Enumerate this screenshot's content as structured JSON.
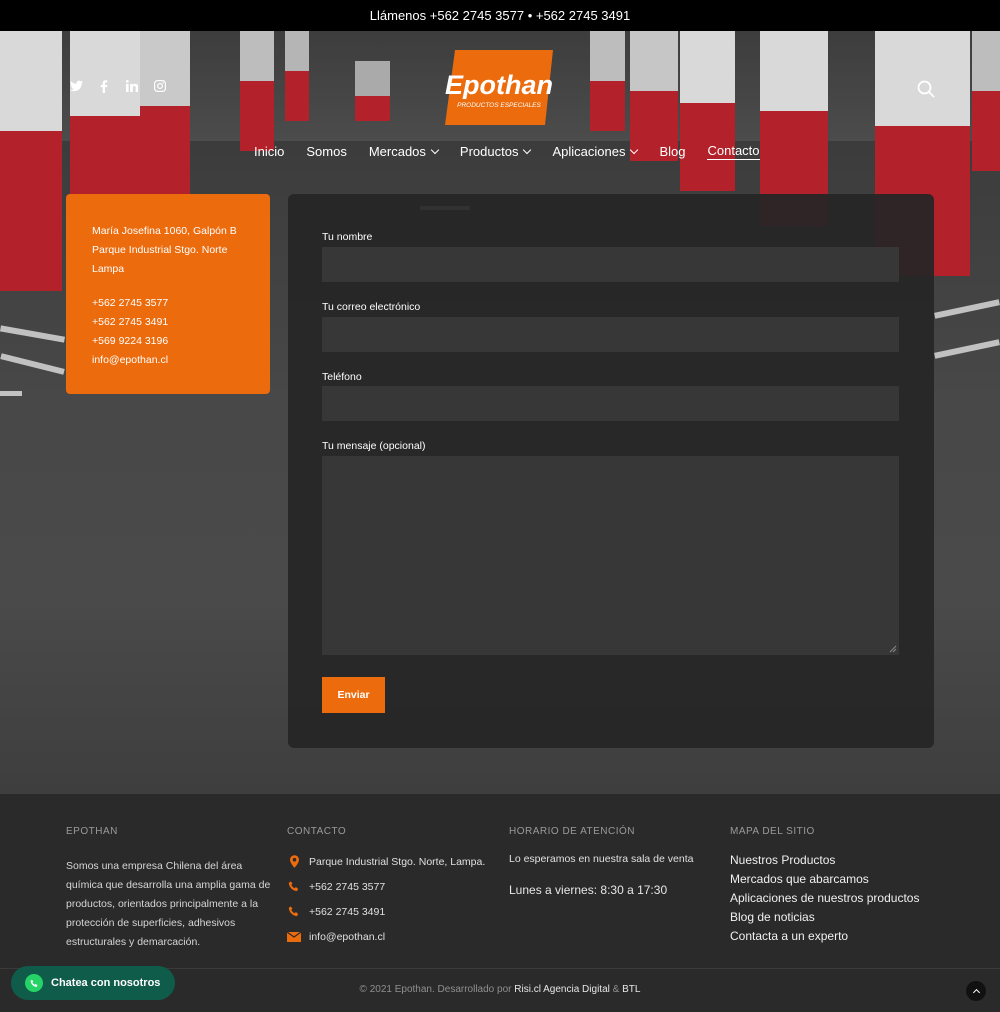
{
  "topbar": {
    "text": "Llámenos +562 2745 3577 • +562 2745 3491"
  },
  "header": {
    "social": [
      "twitter-icon",
      "facebook-icon",
      "linkedin-icon",
      "instagram-icon"
    ],
    "logo": {
      "brand": "Epothan",
      "tagline": "PRODUCTOS ESPECIALES"
    },
    "nav": [
      {
        "label": "Inicio",
        "dropdown": false
      },
      {
        "label": "Somos",
        "dropdown": false
      },
      {
        "label": "Mercados",
        "dropdown": true
      },
      {
        "label": "Productos",
        "dropdown": true
      },
      {
        "label": "Aplicaciones",
        "dropdown": true
      },
      {
        "label": "Blog",
        "dropdown": false
      },
      {
        "label": "Contacto",
        "dropdown": false,
        "active": true
      }
    ]
  },
  "info_card": {
    "address1": "María Josefina 1060, Galpón B",
    "address2": "Parque Industrial Stgo. Norte",
    "address3": "Lampa",
    "phone1": "+562 2745 3577",
    "phone2": "+562 2745 3491",
    "phone3": "+569 9224 3196",
    "email": "info@epothan.cl"
  },
  "form": {
    "name_label": "Tu nombre",
    "email_label": "Tu correo electrónico",
    "phone_label": "Teléfono",
    "message_label": "Tu mensaje (opcional)",
    "send_label": "Enviar"
  },
  "footer": {
    "about": {
      "heading": "EPOTHAN",
      "text": "Somos una empresa Chilena del área química que desarrolla una amplia gama de productos, orientados principalmente a la protección de superficies, adhesivos estructurales y demarcación."
    },
    "contact": {
      "heading": "CONTACTO",
      "address": "Parque Industrial Stgo. Norte, Lampa.",
      "phone1": "+562 2745 3577",
      "phone2": "+562 2745 3491",
      "email": "info@epothan.cl"
    },
    "hours": {
      "heading": "HORARIO DE ATENCIÓN",
      "line1": "Lo esperamos en nuestra sala de venta",
      "line2": "Lunes a viernes: 8:30 a 17:30"
    },
    "sitemap": {
      "heading": "MAPA DEL SITIO",
      "links": [
        "Nuestros Productos",
        "Mercados que abarcamos",
        "Aplicaciones de nuestros productos",
        "Blog de noticias",
        "Contacta a un experto"
      ]
    },
    "copyright_prefix": "© 2021 Epothan. Desarrollado por",
    "credit1": "Risi.cl Agencia Digital",
    "amp": "&",
    "credit2": "BTL"
  },
  "whatsapp": {
    "label": "Chatea con nosotros"
  },
  "colors": {
    "accent": "#ec6b0d",
    "pillar_red": "#b3212a",
    "whatsapp": "#0f5c4a"
  }
}
